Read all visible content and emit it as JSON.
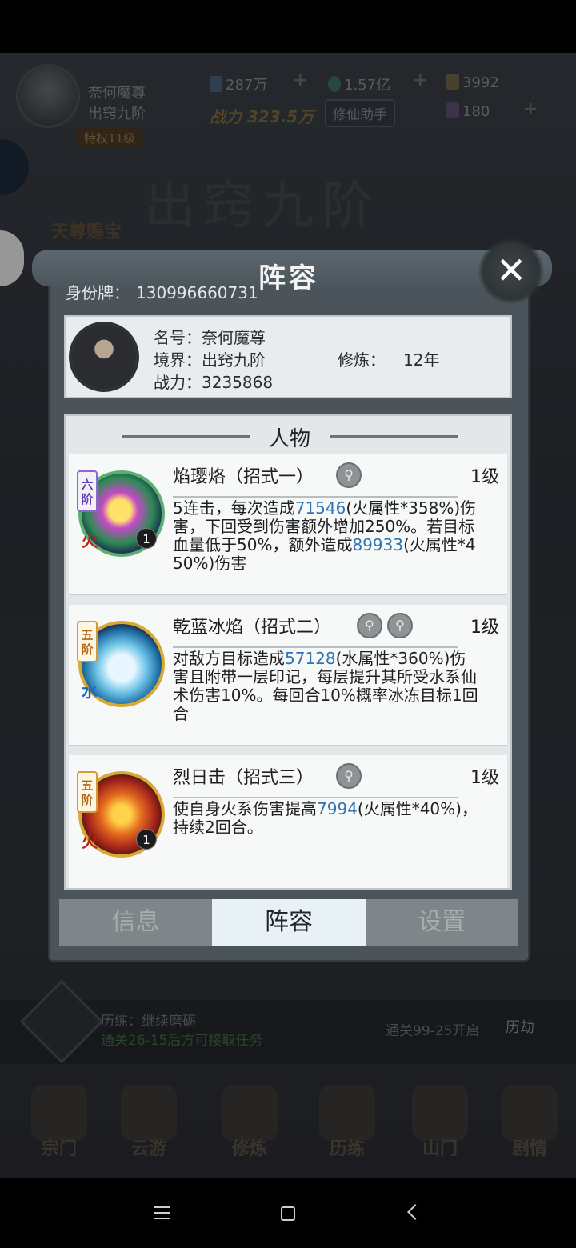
{
  "hud": {
    "player_name": "奈何魔尊",
    "player_rank": "出窍九阶",
    "res1": "287万",
    "res2": "1.57亿",
    "res3": "3992",
    "res4": "180",
    "power": "战力 323.5万",
    "helper_label": "修仙助手",
    "vip_label": "特权11级",
    "big_title": "出窍九阶",
    "left_label": "天尊赐宝"
  },
  "quest": {
    "line1": "历练：继续磨砺",
    "line2": "通关26-15后方可接取任务",
    "line3": "通关99-25开启",
    "button": "历劫"
  },
  "bottom_nav": [
    "宗门",
    "云游",
    "修炼",
    "历练",
    "山门",
    "剧情"
  ],
  "dialog": {
    "title": "阵容",
    "close_icon": "close-icon",
    "id_label": "身份牌：",
    "id_value": "130996660731",
    "profile": {
      "name_label": "名号：",
      "name_value": "奈何魔尊",
      "realm_label": "境界：",
      "realm_value": "出窍九阶",
      "cultivate_label": "修炼：",
      "cultivate_value": "12年",
      "power_label": "战力：",
      "power_value": "3235868"
    },
    "roster_title": "人物",
    "skills": [
      {
        "name": "焰璎烙（招式一）",
        "level": "1级",
        "tier": "六阶",
        "element": "火",
        "count": "1",
        "desc_a": "5连击，每次造成",
        "num_a": "71546",
        "desc_b": "(火属性*358%)伤害，下回受到伤害额外增加250%。若目标血量低于50%，额外造成",
        "num_b": "89933",
        "desc_c": "(火属性*450%)伤害"
      },
      {
        "name": "乾蓝冰焰（招式二）",
        "level": "1级",
        "tier": "五阶",
        "element": "水",
        "count": "",
        "desc_a": "对敌方目标造成",
        "num_a": "57128",
        "desc_b": "(水属性*360%)伤害且附带一层印记，每层提升其所受水系仙术伤害10%。每回合10%概率冰冻目标1回合",
        "num_b": "",
        "desc_c": ""
      },
      {
        "name": "烈日击（招式三）",
        "level": "1级",
        "tier": "五阶",
        "element": "火",
        "count": "1",
        "desc_a": "使自身火系伤害提高",
        "num_a": "7994",
        "desc_b": "(火属性*40%)，持续2回合。",
        "num_b": "",
        "desc_c": ""
      }
    ],
    "tabs": [
      "信息",
      "阵容",
      "设置"
    ],
    "active_tab": "阵容"
  }
}
